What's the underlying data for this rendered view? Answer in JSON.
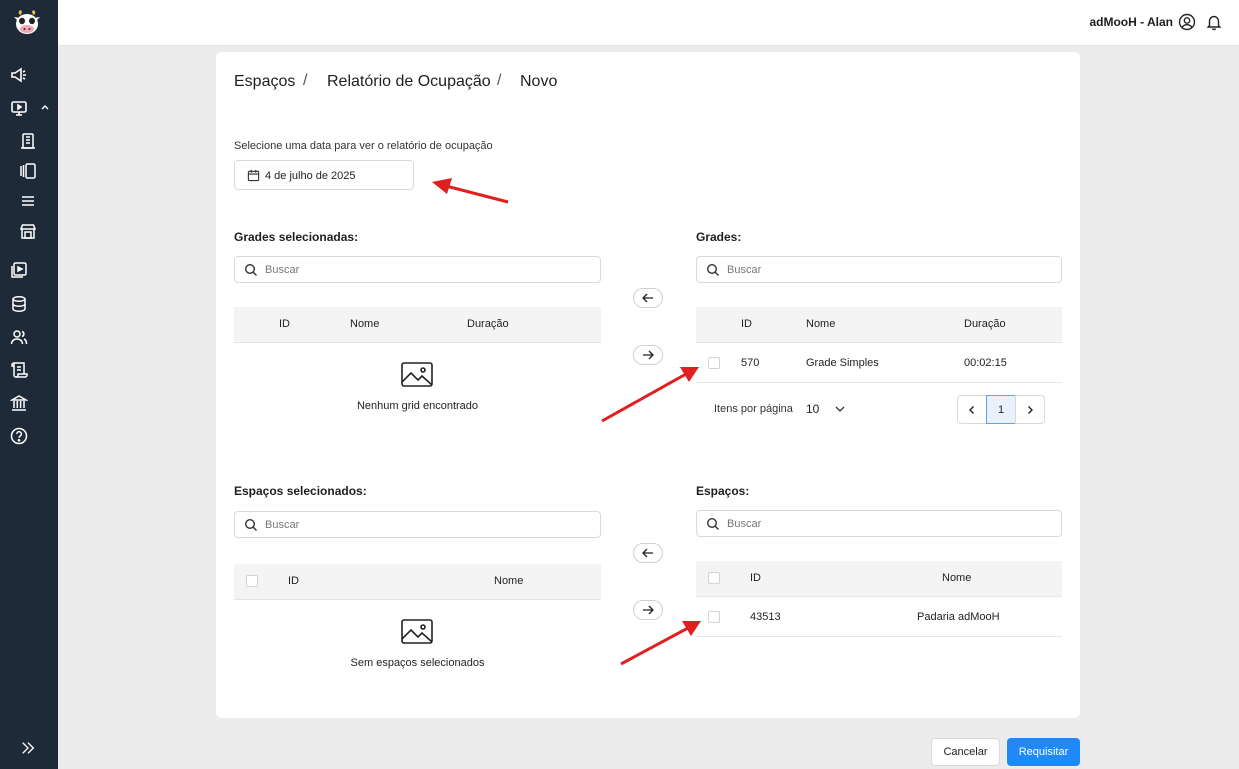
{
  "topbar": {
    "user_name": "adMooH - Alan"
  },
  "sidebar": {
    "icons": [
      "megaphone-icon",
      "monitor-icon",
      "building-icon",
      "panels-icon",
      "menu-icon",
      "store-icon",
      "playlist-icon",
      "database-icon",
      "users-icon",
      "scroll-icon",
      "bank-icon",
      "help-icon",
      "expand-icon"
    ]
  },
  "breadcrumb": {
    "items": [
      "Espaços",
      "Relatório de Ocupação",
      "Novo"
    ],
    "separator": "/"
  },
  "date": {
    "label": "Selecione uma data para ver o relatório de ocupação",
    "value": "4 de julho de 2025"
  },
  "grids_selected": {
    "title": "Grades selecionadas:",
    "search_placeholder": "Buscar",
    "columns": [
      "ID",
      "Nome",
      "Duração"
    ],
    "empty_text": "Nenhum grid encontrado"
  },
  "grids": {
    "title": "Grades:",
    "search_placeholder": "Buscar",
    "columns": [
      "ID",
      "Nome",
      "Duração"
    ],
    "rows": [
      {
        "id": "570",
        "name": "Grade Simples",
        "duration": "00:02:15"
      }
    ],
    "per_page_label": "Itens por página",
    "per_page_value": "10",
    "current_page": "1"
  },
  "spaces_selected": {
    "title": "Espaços selecionados:",
    "search_placeholder": "Buscar",
    "columns": [
      "ID",
      "Nome"
    ],
    "empty_text": "Sem espaços selecionados"
  },
  "spaces": {
    "title": "Espaços:",
    "search_placeholder": "Buscar",
    "columns": [
      "ID",
      "Nome"
    ],
    "rows": [
      {
        "id": "43513",
        "name": "Padaria adMooH"
      }
    ]
  },
  "actions": {
    "cancel": "Cancelar",
    "submit": "Requisitar"
  },
  "colors": {
    "sidebar": "#1f2a38",
    "primary": "#1f8af7",
    "annotation_arrow": "#e02020"
  }
}
